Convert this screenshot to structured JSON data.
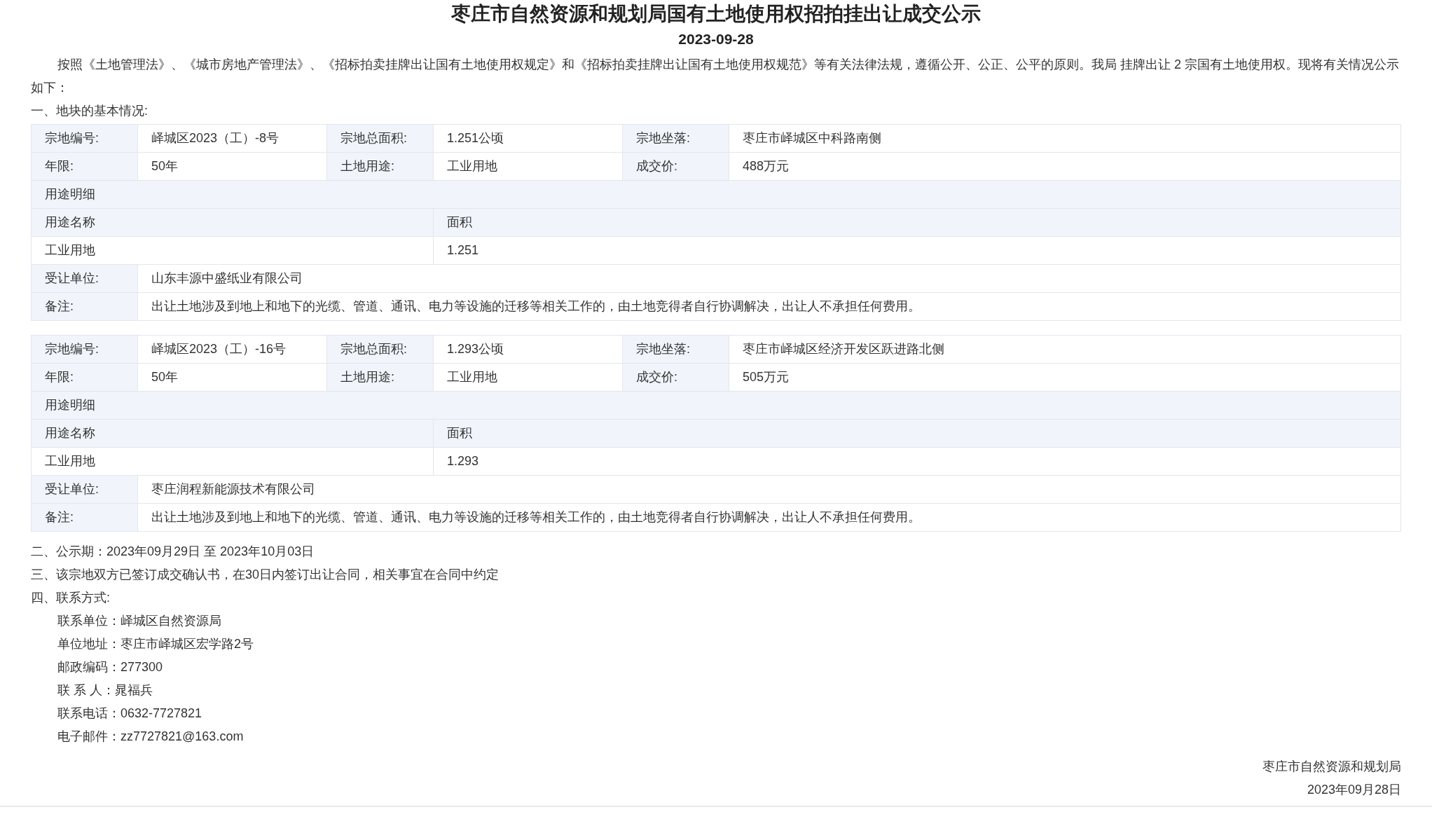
{
  "title": "枣庄市自然资源和规划局国有土地使用权招拍挂出让成交公示",
  "date": "2023-09-28",
  "intro": "按照《土地管理法》、《城市房地产管理法》、《招标拍卖挂牌出让国有土地使用权规定》和《招标拍卖挂牌出让国有土地使用权规范》等有关法律法规，遵循公开、公正、公平的原则。我局 挂牌出让 2 宗国有土地使用权。现将有关情况公示如下：",
  "section_1": "一、地块的基本情况:",
  "parcels": [
    {
      "info": [
        {
          "label": "宗地编号:",
          "value": "峄城区2023（工）-8号"
        },
        {
          "label": "宗地总面积:",
          "value": "1.251公顷"
        },
        {
          "label": "宗地坐落:",
          "value": "枣庄市峄城区中科路南侧"
        },
        {
          "label": "年限:",
          "value": "50年"
        },
        {
          "label": "土地用途:",
          "value": "工业用地"
        },
        {
          "label": "成交价:",
          "value": "488万元"
        }
      ],
      "usage_title": "用途明细",
      "usage_header": {
        "name": "用途名称",
        "area": "面积"
      },
      "usage_rows": [
        {
          "name": "工业用地",
          "area": "1.251"
        }
      ],
      "grantee": {
        "label": "受让单位:",
        "value": "山东丰源中盛纸业有限公司"
      },
      "remarks": {
        "label": "备注:",
        "value": "出让土地涉及到地上和地下的光缆、管道、通讯、电力等设施的迁移等相关工作的，由土地竞得者自行协调解决，出让人不承担任何费用。"
      }
    },
    {
      "info": [
        {
          "label": "宗地编号:",
          "value": "峄城区2023（工）-16号"
        },
        {
          "label": "宗地总面积:",
          "value": "1.293公顷"
        },
        {
          "label": "宗地坐落:",
          "value": "枣庄市峄城区经济开发区跃进路北侧"
        },
        {
          "label": "年限:",
          "value": "50年"
        },
        {
          "label": "土地用途:",
          "value": "工业用地"
        },
        {
          "label": "成交价:",
          "value": "505万元"
        }
      ],
      "usage_title": "用途明细",
      "usage_header": {
        "name": "用途名称",
        "area": "面积"
      },
      "usage_rows": [
        {
          "name": "工业用地",
          "area": "1.293"
        }
      ],
      "grantee": {
        "label": "受让单位:",
        "value": "枣庄润程新能源技术有限公司"
      },
      "remarks": {
        "label": "备注:",
        "value": "出让土地涉及到地上和地下的光缆、管道、通讯、电力等设施的迁移等相关工作的，由土地竞得者自行协调解决，出让人不承担任何费用。"
      }
    }
  ],
  "section_2": "二、公示期：2023年09月29日 至 2023年10月03日",
  "section_3": "三、该宗地双方已签订成交确认书，在30日内签订出让合同，相关事宜在合同中约定",
  "section_4": "四、联系方式:",
  "contacts": [
    "联系单位：峄城区自然资源局",
    "单位地址：枣庄市峄城区宏学路2号",
    "邮政编码：277300",
    "联 系 人：晁福兵",
    "联系电话：0632-7727821",
    "电子邮件：zz7727821@163.com"
  ],
  "signature": {
    "org": "枣庄市自然资源和规划局",
    "date": "2023年09月28日"
  }
}
